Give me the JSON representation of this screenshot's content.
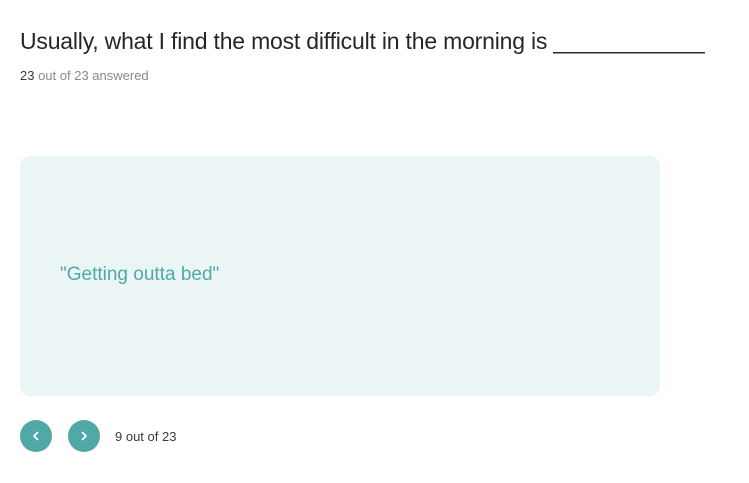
{
  "question": {
    "title": "Usually, what I find the most difficult in the morning is ____________"
  },
  "progress": {
    "answered_count": "23",
    "answered_suffix": " out of 23 answered"
  },
  "response_card": {
    "text": "\"Getting outta bed\""
  },
  "navigation": {
    "prev_icon": "chevron-left-icon",
    "next_icon": "chevron-right-icon",
    "position_text": "9 out of 23",
    "button_color": "#4fa9a7"
  },
  "colors": {
    "accent": "#4fa9a7",
    "card_background": "#ecf5f5"
  }
}
